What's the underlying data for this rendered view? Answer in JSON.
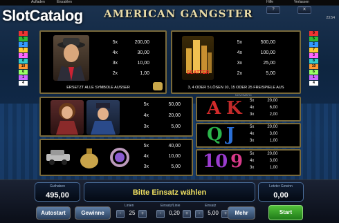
{
  "watermark": "SlotCatalog",
  "top_bar": {
    "left_links": [
      "Aufladen",
      "Einzahlen"
    ],
    "right_links": [
      "Hilfe",
      "Verlassen"
    ],
    "time": "23:54"
  },
  "game_title": "AMERICAN GANGSTER",
  "side_lines_left": [
    "9",
    "5",
    "2",
    "7",
    "3",
    "8",
    "10",
    "6",
    "1",
    "4"
  ],
  "side_lines_right": [
    "9",
    "5",
    "2",
    "7",
    "3",
    "8",
    "10",
    "6",
    "1",
    "4"
  ],
  "paytable": {
    "gangster": {
      "rows": [
        {
          "m": "5x",
          "v": "200,00"
        },
        {
          "m": "4x",
          "v": "30,00"
        },
        {
          "m": "3x",
          "v": "10,00"
        },
        {
          "m": "2x",
          "v": "1,00"
        }
      ],
      "caption": "ERSETZT ALLE SYMBOLE AUSSER"
    },
    "scatter": {
      "label": "SCATTER",
      "rows": [
        {
          "m": "5x",
          "v": "500,00"
        },
        {
          "m": "4x",
          "v": "100,00"
        },
        {
          "m": "3x",
          "v": "25,00"
        },
        {
          "m": "2x",
          "v": "5,00"
        }
      ],
      "caption": "3, 4 ODER 5 LÖSEN 10, 15 ODER 25 FREISPIELE AUS"
    },
    "people": {
      "rows": [
        {
          "m": "5x",
          "v": "50,00"
        },
        {
          "m": "4x",
          "v": "20,00"
        },
        {
          "m": "3x",
          "v": "5,00"
        }
      ]
    },
    "items": {
      "rows": [
        {
          "m": "5x",
          "v": "40,00"
        },
        {
          "m": "4x",
          "v": "10,00"
        },
        {
          "m": "3x",
          "v": "5,00"
        }
      ]
    },
    "ak": {
      "letters": [
        "A",
        "K"
      ],
      "rows": [
        {
          "m": "5x",
          "v": "20,00"
        },
        {
          "m": "4x",
          "v": "6,00"
        },
        {
          "m": "3x",
          "v": "2,00"
        }
      ]
    },
    "qj": {
      "letters": [
        "Q",
        "J"
      ],
      "rows": [
        {
          "m": "5x",
          "v": "20,00"
        },
        {
          "m": "4x",
          "v": "3,00"
        },
        {
          "m": "3x",
          "v": "1,00"
        }
      ]
    },
    "ten_nine": {
      "letters": [
        "10",
        "9"
      ],
      "rows": [
        {
          "m": "5x",
          "v": "20,00"
        },
        {
          "m": "4x",
          "v": "3,00"
        },
        {
          "m": "3x",
          "v": "1,00"
        }
      ]
    },
    "brand": "NOVOMATIC"
  },
  "bottom": {
    "balance_label": "Guthaben",
    "balance": "495,00",
    "message": "Bitte Einsatz wählen",
    "last_win_label": "Letzter Gewinn",
    "last_win": "0,00",
    "autostart": "Autostart",
    "gamble": "Gewinne",
    "lines_label": "Linien",
    "lines": "25",
    "bet_per_line_label": "Einsatz/Linie",
    "bet_per_line": "0,20",
    "total_bet_label": "Einsatz",
    "total_bet": "5,00",
    "more": "Mehr",
    "start": "Start",
    "minus": "-",
    "plus": "+"
  },
  "colors": {
    "panel_border": "#7a6a3a",
    "start_button": "#3aa02a",
    "letter_A": "#d22a2a",
    "letter_Q": "#2bb44a",
    "letter_J": "#2a6fd6",
    "letter_10": "#9b3ccf"
  }
}
